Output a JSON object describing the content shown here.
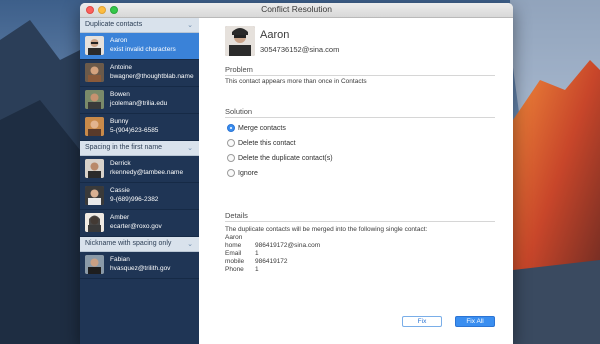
{
  "window": {
    "title": "Conflict Resolution"
  },
  "sidebar": {
    "groups": [
      {
        "header": "Duplicate contacts",
        "contacts": [
          {
            "name": "Aaron",
            "detail": "exist invalid characters",
            "selected": true
          },
          {
            "name": "Antoine",
            "detail": "bwagner@thoughtblab.name"
          },
          {
            "name": "Bowen",
            "detail": "jcoleman@trilia.edu"
          },
          {
            "name": "Bunny",
            "detail": "5-(904)623-6585"
          }
        ]
      },
      {
        "header": "Spacing in the first name",
        "contacts": [
          {
            "name": "Derrick",
            "detail": "rkennedy@tambee.name"
          },
          {
            "name": "Cassie",
            "detail": "9-(689)996-2382"
          },
          {
            "name": "Amber",
            "detail": "ecarter@roxo.gov"
          }
        ]
      },
      {
        "header": "Nickname with spacing only",
        "contacts": [
          {
            "name": "Fabian",
            "detail": "hvasquez@trilith.gov"
          }
        ]
      }
    ]
  },
  "main": {
    "name": "Aaron",
    "phone": "3054736152@sina.com",
    "problem_label": "Problem",
    "problem_text": "This contact appears more than once in Contacts",
    "solution_label": "Solution",
    "options": [
      {
        "label": "Merge contacts",
        "selected": true
      },
      {
        "label": "Delete this contact"
      },
      {
        "label": "Delete the duplicate contact(s)"
      },
      {
        "label": "Ignore"
      }
    ],
    "details_label": "Details",
    "details_intro": "The duplicate contacts will be merged into the following single contact:",
    "details_name": "Aaron",
    "details_fields": [
      {
        "key": "home",
        "value": "986419172@sina.com"
      },
      {
        "key": "Email",
        "value": "1"
      },
      {
        "key": "mobile",
        "value": "986419172"
      },
      {
        "key": "Phone",
        "value": "1"
      }
    ],
    "fix_label": "Fix",
    "fix_all_label": "Fix All"
  },
  "colors": {
    "accent": "#3a8ef0",
    "sidebar_bg": "#1f3555",
    "selected_row": "#3a82d8"
  }
}
